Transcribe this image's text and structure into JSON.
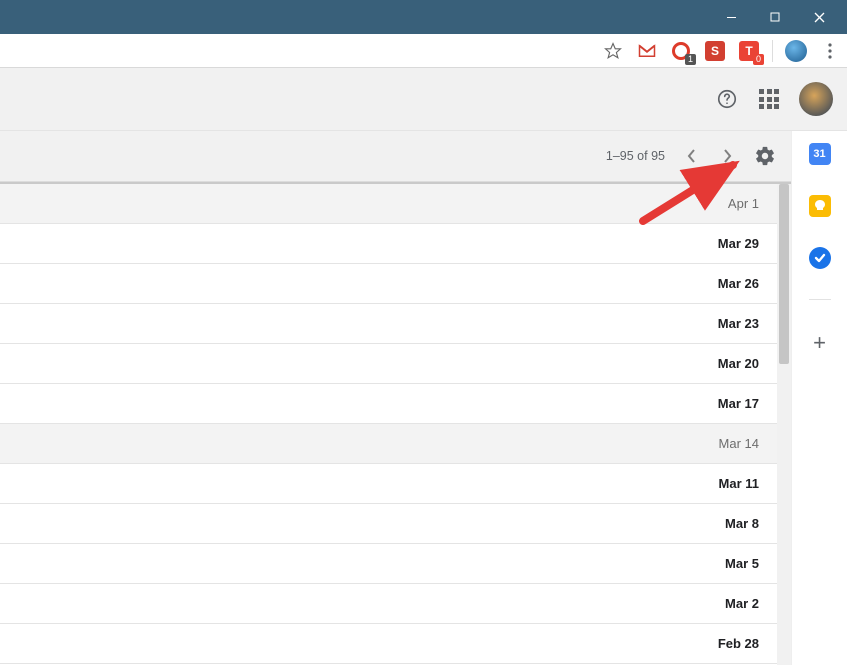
{
  "titlebar": {
    "minimize_icon": "minimize-icon",
    "maximize_icon": "maximize-icon",
    "close_icon": "close-icon"
  },
  "chrome": {
    "extensions": [
      {
        "name": "star-icon"
      },
      {
        "name": "gmail-icon",
        "label": "M",
        "color": "#d23f31"
      },
      {
        "name": "ext-o-icon",
        "label": "O",
        "color": "#dd3b2a",
        "badge": "1"
      },
      {
        "name": "ext-s-icon",
        "label": "S",
        "color": "#d23f31"
      },
      {
        "name": "ext-t-icon",
        "label": "T",
        "color": "#ea4335",
        "badge": "0"
      }
    ],
    "menu_icon": "kebab-menu-icon"
  },
  "header": {
    "help_icon": "help-icon",
    "apps_icon": "apps-grid-icon",
    "avatar_icon": "profile-avatar"
  },
  "toolbar": {
    "pagination": "1–95 of 95",
    "prev_icon": "chevron-left-icon",
    "next_icon": "chevron-right-icon",
    "settings_icon": "gear-icon"
  },
  "messages": [
    {
      "date": "Apr 1",
      "read": true
    },
    {
      "date": "Mar 29",
      "read": false
    },
    {
      "date": "Mar 26",
      "read": false
    },
    {
      "date": "Mar 23",
      "read": false
    },
    {
      "date": "Mar 20",
      "read": false
    },
    {
      "date": "Mar 17",
      "read": false
    },
    {
      "date": "Mar 14",
      "read": true
    },
    {
      "date": "Mar 11",
      "read": false
    },
    {
      "date": "Mar 8",
      "read": false
    },
    {
      "date": "Mar 5",
      "read": false
    },
    {
      "date": "Mar 2",
      "read": false
    },
    {
      "date": "Feb 28",
      "read": false
    }
  ],
  "sidepanel": {
    "calendar_label": "31",
    "keep_icon": "keep-icon",
    "tasks_icon": "tasks-icon",
    "add_icon": "plus-icon"
  }
}
